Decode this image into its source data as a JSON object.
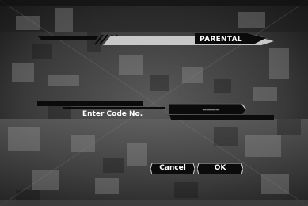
{
  "dialog": {
    "title": "PARENTAL",
    "code_prompt": "Enter Code No.",
    "code_value": "____"
  },
  "buttons": {
    "cancel_label": "Cancel",
    "ok_label": "OK"
  },
  "colors": {
    "panel": "#0b0b0b",
    "title_bar": "#c8c8c8",
    "text": "#ffffff"
  }
}
